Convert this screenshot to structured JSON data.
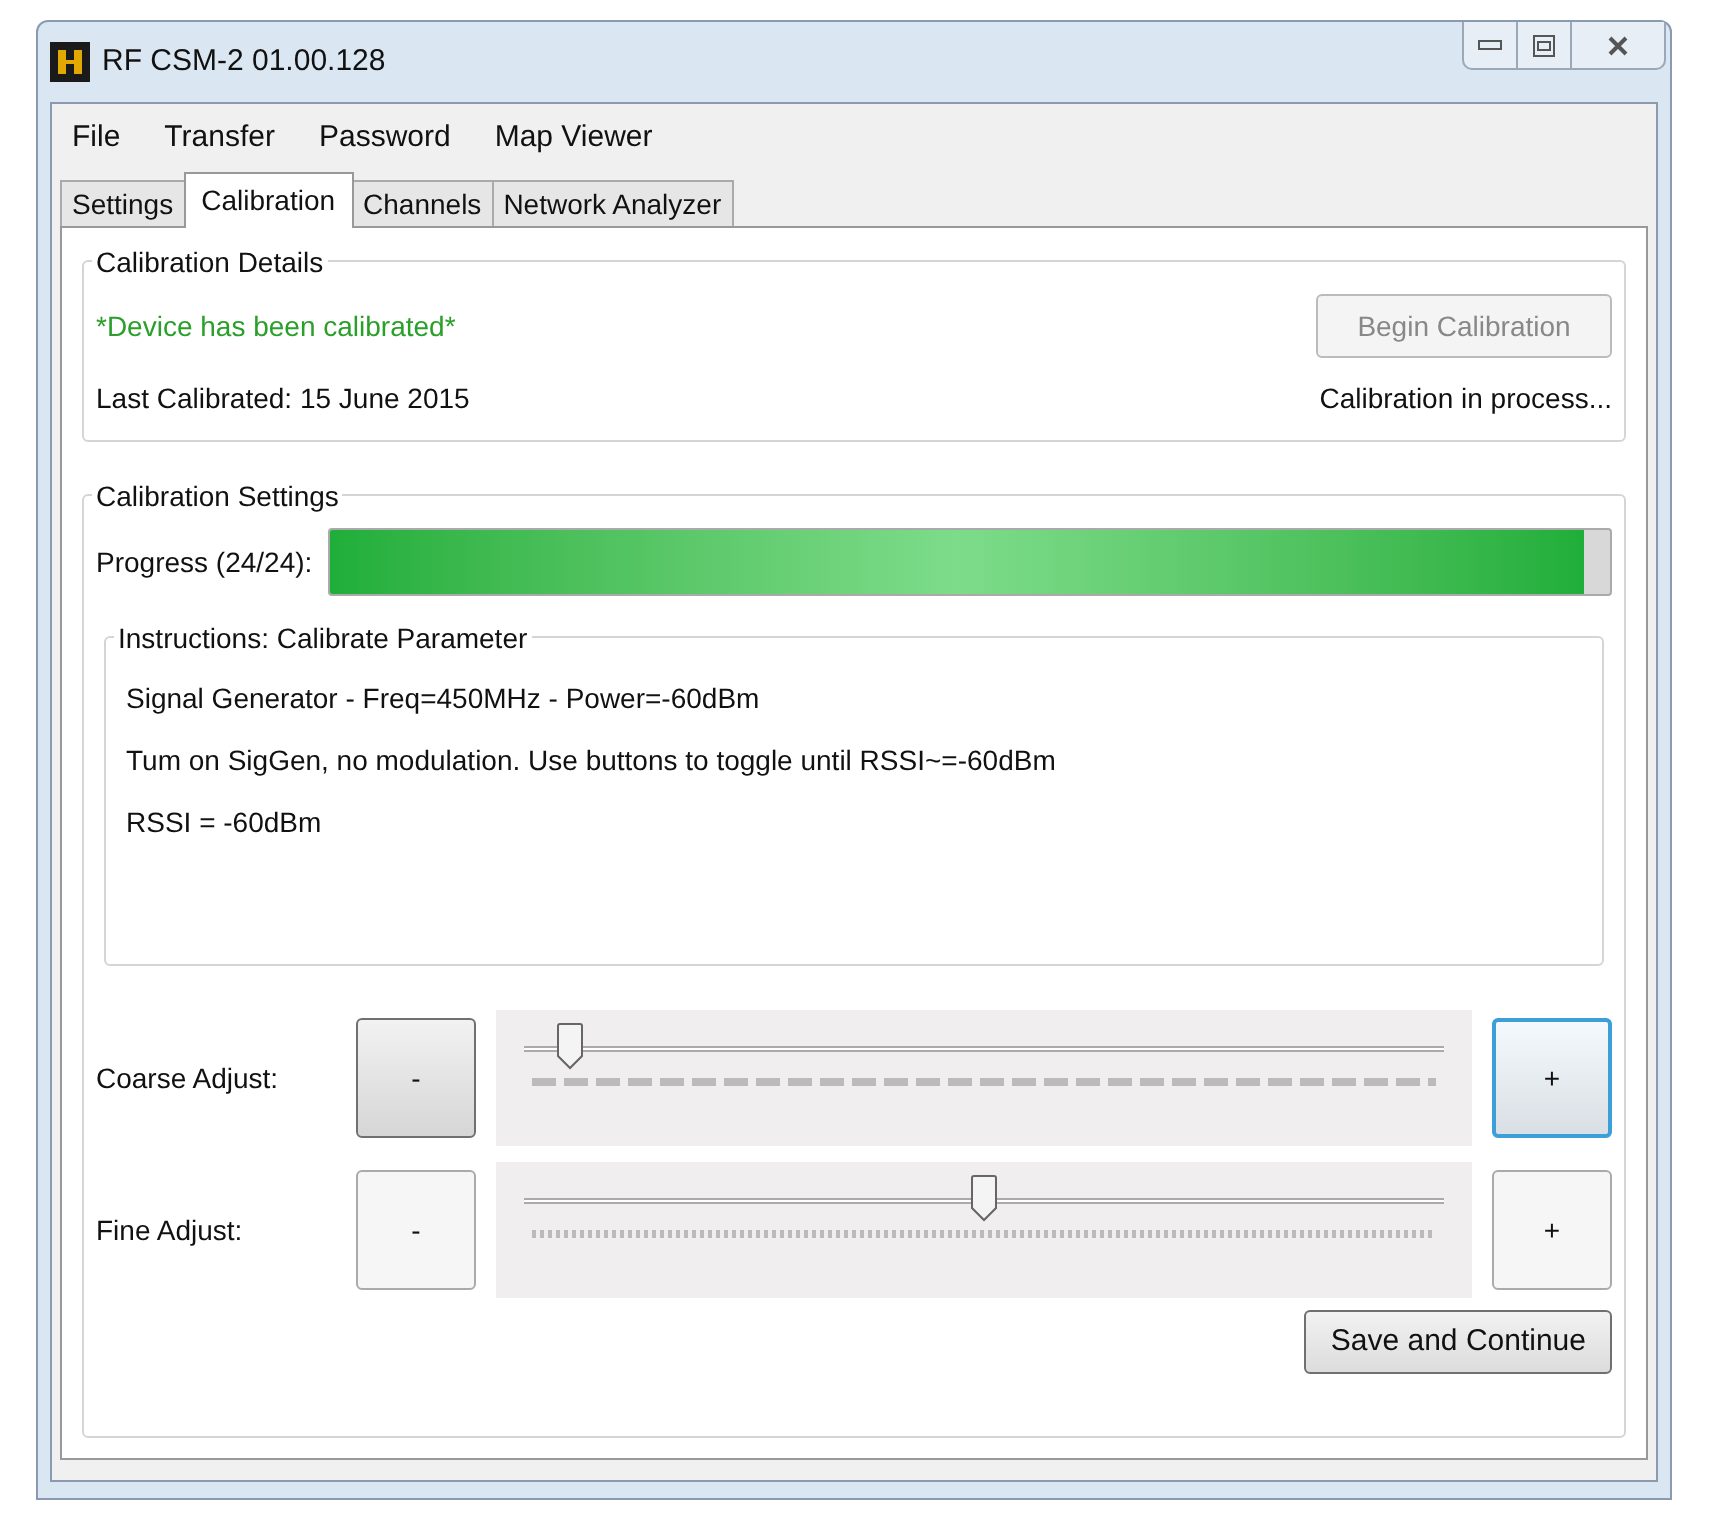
{
  "window": {
    "title": "RF CSM-2 01.00.128"
  },
  "menu": [
    "File",
    "Transfer",
    "Password",
    "Map Viewer"
  ],
  "tabs": [
    {
      "label": "Settings",
      "selected": false
    },
    {
      "label": "Calibration",
      "selected": true
    },
    {
      "label": "Channels",
      "selected": false
    },
    {
      "label": "Network Analyzer",
      "selected": false
    }
  ],
  "calibration_details": {
    "title": "Calibration Details",
    "status": "*Device has been calibrated*",
    "last_calibrated": "Last Calibrated: 15 June 2015",
    "button": {
      "label": "Begin Calibration",
      "disabled": true
    },
    "process_status": "Calibration in process..."
  },
  "calibration_settings": {
    "title": "Calibration Settings",
    "progress": {
      "label": "Progress (24/24):",
      "level": 0.98
    },
    "instructions": {
      "title": "Instructions: Calibrate Parameter",
      "lines": [
        "Signal Generator - Freq=450MHz - Power=-60dBm",
        "Tum on SigGen, no modulation. Use buttons to toggle until RSSI~=-60dBm",
        "RSSI = -60dBm"
      ]
    },
    "adjusters": [
      {
        "label": "Coarse Adjust:",
        "minus": "-",
        "plus": "+",
        "level": 0.05,
        "kind": "coarse",
        "plus_focused": true
      },
      {
        "label": "Fine Adjust:",
        "minus": "-",
        "plus": "+",
        "level": 0.5,
        "kind": "fine",
        "plus_focused": false
      }
    ],
    "save_button": "Save and Continue"
  }
}
